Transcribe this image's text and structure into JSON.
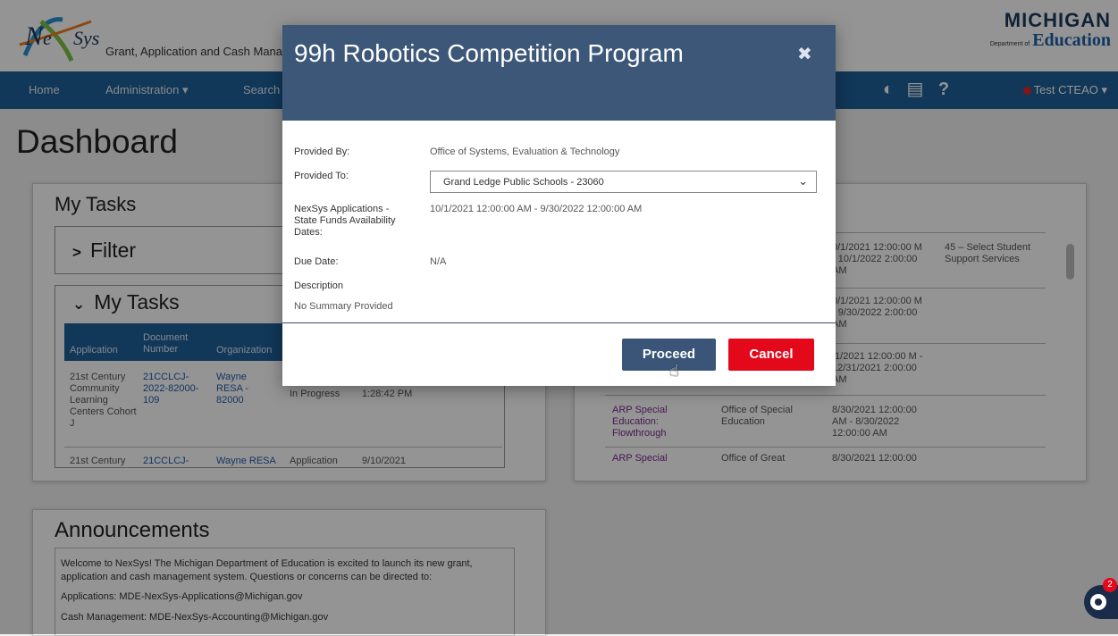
{
  "app": {
    "name": "NexSys",
    "subtitle": "Grant, Application and Cash Manage",
    "org_logo_line1": "MICHIGAN",
    "org_logo_small": "Department of",
    "org_logo_line2": "Education"
  },
  "nav": {
    "items": [
      "Home",
      "Administration ▾",
      "Search"
    ],
    "user": "Test CTEAO ▾",
    "icons": [
      "contrast-icon",
      "notes-icon",
      "help-icon"
    ]
  },
  "page": {
    "title": "Dashboard"
  },
  "tasks_panel": {
    "title": "My Tasks",
    "filter_label": "Filter",
    "subpanel_label": "My Tasks",
    "columns": [
      "Application",
      "Document Number",
      "Organization"
    ],
    "rows": [
      {
        "application": "21st Century Community Learning Centers Cohort J",
        "document": "21CCLCJ-2022-82000-109",
        "organization": "Wayne RESA - 82000",
        "status": "In Progress",
        "date": "1:28:42 PM"
      },
      {
        "application": "21st Century",
        "document": "21CCLCJ-",
        "organization": "Wayne RESA",
        "status": "Application",
        "date": "9/10/2021"
      }
    ]
  },
  "right_panel": {
    "rows": [
      {
        "dates": "0/1/2021 12:00:00 M - 10/1/2022 2:00:00 AM",
        "extra": "45 – Select Student Support Services"
      },
      {
        "dates": "0/1/2021 12:00:00 M - 9/30/2022 2:00:00 AM",
        "extra": ""
      },
      {
        "dates": "/1/2021 12:00:00 M - 12/31/2021 2:00:00 AM",
        "extra": ""
      },
      {
        "name": "ARP Special Education: Flowthrough",
        "office": "Office of Special Education",
        "dates": "8/30/2021 12:00:00 AM - 8/30/2022 12:00:00 AM"
      },
      {
        "name": "ARP Special",
        "office": "Office of Great",
        "dates": "8/30/2021 12:00:00"
      }
    ]
  },
  "announcements": {
    "title": "Announcements",
    "lines": [
      "Welcome to NexSys!  The Michigan Department of Education is excited to launch its new grant, application and cash management system.  Questions or concerns can be directed to:",
      "Applications:  MDE-NexSys-Applications@Michigan.gov",
      "Cash Management:  MDE-NexSys-Accounting@Michigan.gov"
    ]
  },
  "modal": {
    "title": "99h Robotics Competition Program",
    "close": "✖",
    "provided_by_label": "Provided By:",
    "provided_by_value": "Office of Systems, Evaluation & Technology",
    "provided_to_label": "Provided To:",
    "provided_to_value": "Grand Ledge Public Schools - 23060",
    "availability_label": "NexSys Applications - State Funds Availability Dates:",
    "availability_value": "10/1/2021 12:00:00 AM - 9/30/2022 12:00:00 AM",
    "due_label": "Due Date:",
    "due_value": "N/A",
    "description_label": "Description",
    "description_value": "No Summary Provided",
    "proceed": "Proceed",
    "cancel": "Cancel"
  },
  "chat": {
    "badge_count": "2"
  },
  "colors": {
    "nav_blue": "#1e5f9a",
    "modal_header": "#3d5778",
    "proceed": "#3a5578",
    "cancel": "#e4081b"
  }
}
